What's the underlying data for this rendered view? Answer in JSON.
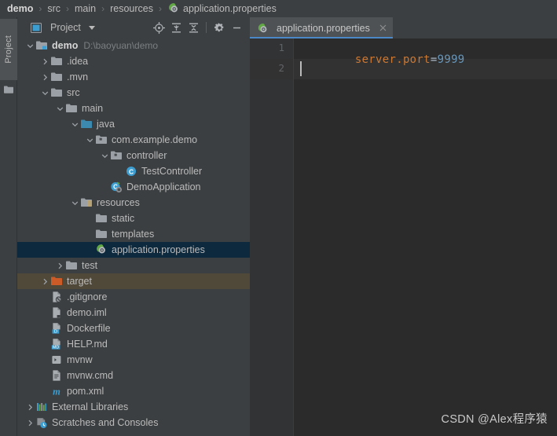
{
  "breadcrumb": {
    "name": "breadcrumb",
    "items": [
      {
        "label": "demo",
        "icon": "none",
        "root": true
      },
      {
        "label": "src",
        "icon": "none",
        "root": false
      },
      {
        "label": "main",
        "icon": "none",
        "root": false
      },
      {
        "label": "resources",
        "icon": "none",
        "root": false
      },
      {
        "label": "application.properties",
        "icon": "properties-file-icon",
        "root": false
      }
    ],
    "separator": "›"
  },
  "tool_stripe": {
    "project_label": "Project",
    "folder_icon": "folder-icon"
  },
  "project_panel": {
    "title": "Project",
    "title_icon": "project-view-icon",
    "caret_icon": "chevron-down-icon",
    "toolbar_buttons": [
      {
        "name": "locate-icon",
        "tooltip": "Select Opened File"
      },
      {
        "name": "expand-all-icon",
        "tooltip": "Expand All"
      },
      {
        "name": "collapse-all-icon",
        "tooltip": "Collapse All"
      },
      {
        "name": "gear-icon",
        "tooltip": "Settings"
      },
      {
        "name": "minimize-icon",
        "tooltip": "Hide"
      }
    ],
    "tree": [
      {
        "label": "demo",
        "path": "D:\\baoyuan\\demo",
        "icon": "module-folder-icon",
        "depth": 0,
        "arrow": "expanded",
        "bold": true,
        "state": "normal"
      },
      {
        "label": ".idea",
        "path": "",
        "icon": "folder-icon",
        "depth": 1,
        "arrow": "collapsed",
        "bold": false,
        "state": "normal"
      },
      {
        "label": ".mvn",
        "path": "",
        "icon": "folder-icon",
        "depth": 1,
        "arrow": "collapsed",
        "bold": false,
        "state": "normal"
      },
      {
        "label": "src",
        "path": "",
        "icon": "folder-icon",
        "depth": 1,
        "arrow": "expanded",
        "bold": false,
        "state": "normal"
      },
      {
        "label": "main",
        "path": "",
        "icon": "folder-icon",
        "depth": 2,
        "arrow": "expanded",
        "bold": false,
        "state": "normal"
      },
      {
        "label": "java",
        "path": "",
        "icon": "source-folder-icon",
        "depth": 3,
        "arrow": "expanded",
        "bold": false,
        "state": "normal"
      },
      {
        "label": "com.example.demo",
        "path": "",
        "icon": "package-icon",
        "depth": 4,
        "arrow": "expanded",
        "bold": false,
        "state": "normal"
      },
      {
        "label": "controller",
        "path": "",
        "icon": "package-icon",
        "depth": 5,
        "arrow": "expanded",
        "bold": false,
        "state": "normal"
      },
      {
        "label": "TestController",
        "path": "",
        "icon": "java-class-icon",
        "depth": 6,
        "arrow": "none",
        "bold": false,
        "state": "normal"
      },
      {
        "label": "DemoApplication",
        "path": "",
        "icon": "spring-boot-class-icon",
        "depth": 5,
        "arrow": "none",
        "bold": false,
        "state": "normal"
      },
      {
        "label": "resources",
        "path": "",
        "icon": "resources-folder-icon",
        "depth": 3,
        "arrow": "expanded",
        "bold": false,
        "state": "normal"
      },
      {
        "label": "static",
        "path": "",
        "icon": "folder-icon",
        "depth": 4,
        "arrow": "none",
        "bold": false,
        "state": "normal"
      },
      {
        "label": "templates",
        "path": "",
        "icon": "folder-icon",
        "depth": 4,
        "arrow": "none",
        "bold": false,
        "state": "normal"
      },
      {
        "label": "application.properties",
        "path": "",
        "icon": "properties-file-icon",
        "depth": 4,
        "arrow": "none",
        "bold": false,
        "state": "selected"
      },
      {
        "label": "test",
        "path": "",
        "icon": "folder-icon",
        "depth": 2,
        "arrow": "collapsed",
        "bold": false,
        "state": "normal"
      },
      {
        "label": "target",
        "path": "",
        "icon": "excluded-folder-icon",
        "depth": 1,
        "arrow": "collapsed",
        "bold": false,
        "state": "excluded"
      },
      {
        "label": ".gitignore",
        "path": "",
        "icon": "gitignore-file-icon",
        "depth": 1,
        "arrow": "none",
        "bold": false,
        "state": "normal"
      },
      {
        "label": "demo.iml",
        "path": "",
        "icon": "iml-file-icon",
        "depth": 1,
        "arrow": "none",
        "bold": false,
        "state": "normal"
      },
      {
        "label": "Dockerfile",
        "path": "",
        "icon": "dockerfile-icon",
        "depth": 1,
        "arrow": "none",
        "bold": false,
        "state": "normal"
      },
      {
        "label": "HELP.md",
        "path": "",
        "icon": "markdown-file-icon",
        "depth": 1,
        "arrow": "none",
        "bold": false,
        "state": "normal"
      },
      {
        "label": "mvnw",
        "path": "",
        "icon": "shell-script-icon",
        "depth": 1,
        "arrow": "none",
        "bold": false,
        "state": "normal"
      },
      {
        "label": "mvnw.cmd",
        "path": "",
        "icon": "cmd-file-icon",
        "depth": 1,
        "arrow": "none",
        "bold": false,
        "state": "normal"
      },
      {
        "label": "pom.xml",
        "path": "",
        "icon": "maven-pom-icon",
        "depth": 1,
        "arrow": "none",
        "bold": false,
        "state": "normal"
      },
      {
        "label": "External Libraries",
        "path": "",
        "icon": "external-libraries-icon",
        "depth": 0,
        "arrow": "collapsed",
        "bold": false,
        "state": "normal"
      },
      {
        "label": "Scratches and Consoles",
        "path": "",
        "icon": "scratches-icon",
        "depth": 0,
        "arrow": "collapsed",
        "bold": false,
        "state": "normal"
      }
    ]
  },
  "editor": {
    "tab": {
      "label": "application.properties",
      "icon": "properties-file-icon",
      "close_icon": "close-icon",
      "active": true
    },
    "line_numbers": [
      "1",
      "2"
    ],
    "code_lines": [
      {
        "key": "server.port",
        "eq": "=",
        "value": "9999"
      },
      {
        "key": "",
        "eq": "",
        "value": ""
      }
    ],
    "cursor_line": 2
  },
  "watermark": {
    "text": "CSDN @Alex程序猿"
  },
  "colors": {
    "panel_bg": "#3c3f41",
    "editor_bg": "#2b2b2b",
    "selection_bg": "#0d293e",
    "excluded_bg": "#50493a",
    "accent_blue": "#4a88c7",
    "key_orange": "#cc7832",
    "value_blue": "#6897bb"
  }
}
